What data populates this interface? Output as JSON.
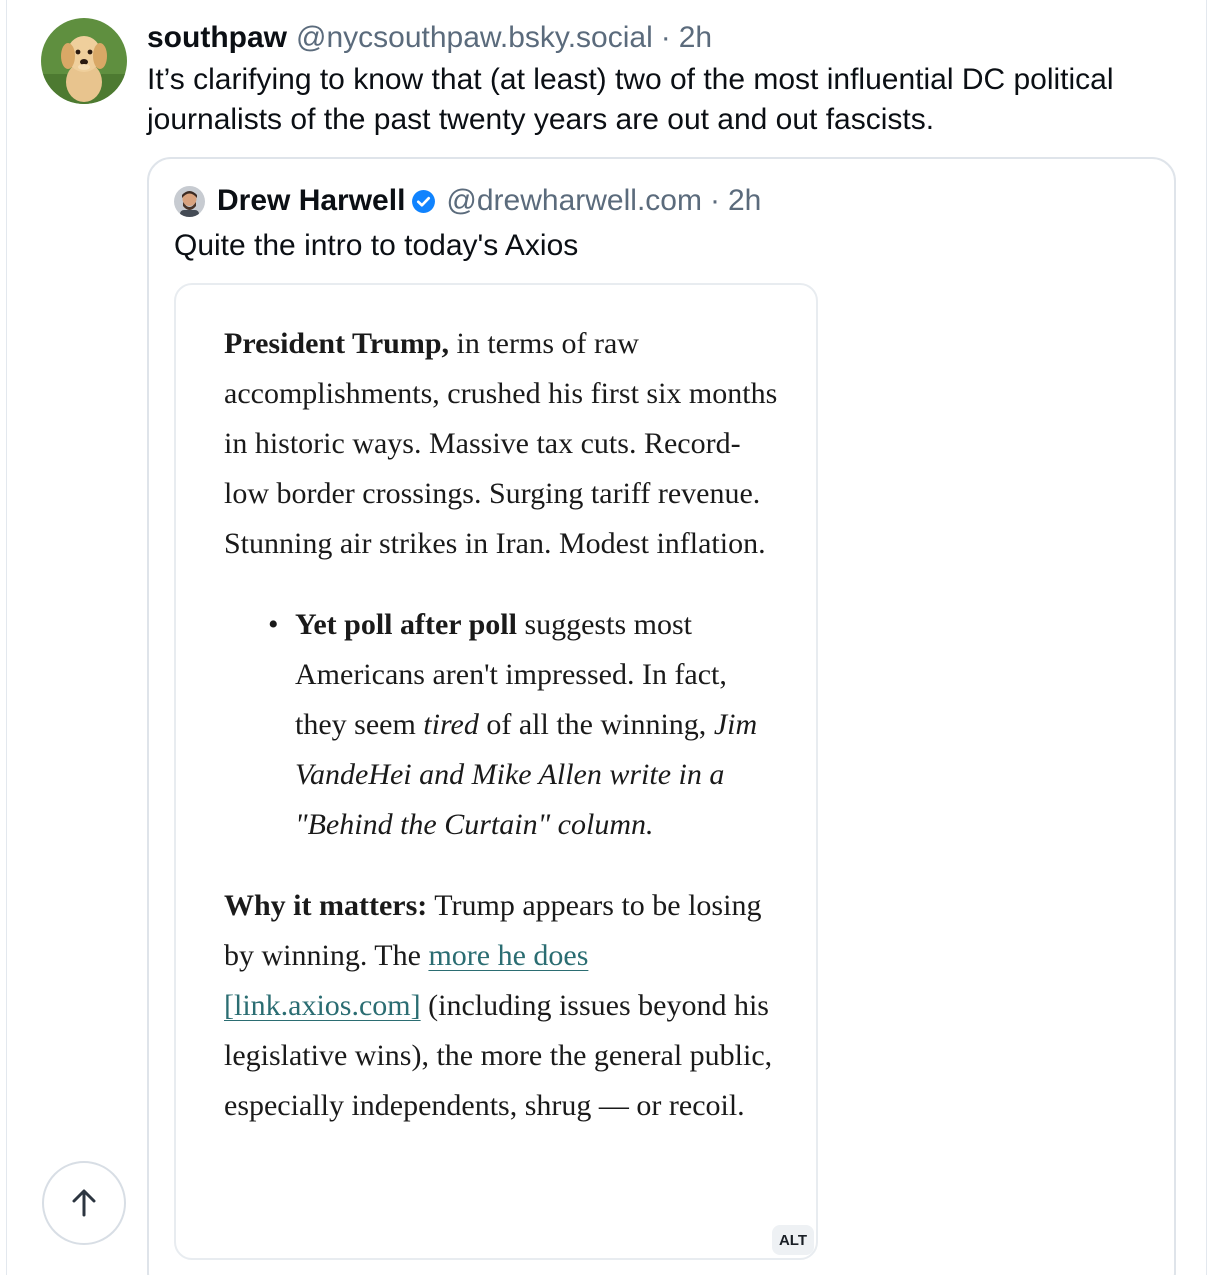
{
  "post": {
    "author_name": "southpaw",
    "author_handle": "@nycsouthpaw.bsky.social",
    "separator": "·",
    "timestamp": "2h",
    "avatar_icon": "golden-retriever-puppy-avatar",
    "text": "It’s clarifying to know that (at least) two of the most influential DC political journalists of the past twenty years are out and out fascists."
  },
  "quote": {
    "author_name": "Drew Harwell",
    "verified_icon": "verified-check-icon",
    "author_handle": "@drewharwell.com",
    "separator": "·",
    "timestamp": "2h",
    "text": "Quite the intro to today's Axios",
    "image": {
      "alt_badge": "ALT",
      "paragraph1": {
        "bold_lead": "President Trump,",
        "text": " in terms of raw accomplishments, crushed his first six months in historic ways. Massive tax cuts. Record-low border crossings. Surging tariff revenue. Stunning air strikes in Iran. Modest inflation."
      },
      "bullet": {
        "mark": "•",
        "bold_lead": "Yet poll after poll",
        "text_before_italic": " suggests most Americans aren't impressed. In fact, they seem ",
        "italic_word": "tired",
        "text_after_italic": " of all the winning, ",
        "italic_credit": "Jim VandeHei and Mike Allen write in a \"Behind the Curtain\" column."
      },
      "paragraph2": {
        "bold_lead": "Why it matters:",
        "text_before_link": " Trump appears to be losing by winning. The ",
        "link_text": "more he does [link.axios.com]",
        "text_after_link": " (including issues beyond his legislative wins), the more the general public, especially independents, shrug — or recoil."
      }
    }
  },
  "scroll_top_button": {
    "icon": "arrow-up-icon"
  },
  "colors": {
    "muted_text": "#5b6b7c",
    "border": "#dfe4ea",
    "link": "#2b6d72",
    "verified_blue": "#1083fe"
  }
}
